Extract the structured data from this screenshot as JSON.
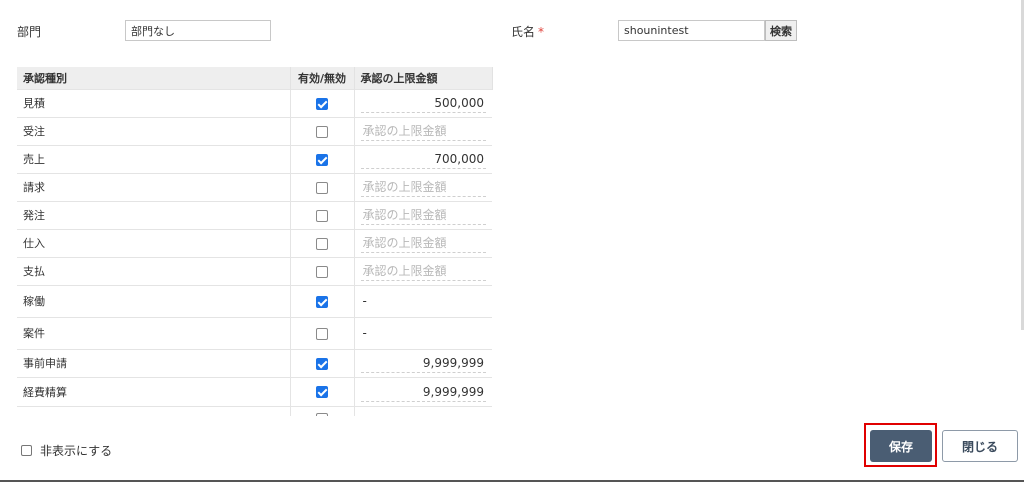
{
  "form": {
    "department_label": "部門",
    "department_value": "部門なし",
    "name_label": "氏名",
    "name_required_mark": "*",
    "name_value": "shounintest",
    "search_label": "検索"
  },
  "table": {
    "headers": [
      "承認種別",
      "有効/無効",
      "承認の上限金額"
    ],
    "amount_placeholder": "承認の上限金額",
    "rows": [
      {
        "type": "見積",
        "enabled": true,
        "amount": "500,000"
      },
      {
        "type": "受注",
        "enabled": false,
        "amount": ""
      },
      {
        "type": "売上",
        "enabled": true,
        "amount": "700,000"
      },
      {
        "type": "請求",
        "enabled": false,
        "amount": ""
      },
      {
        "type": "発注",
        "enabled": false,
        "amount": ""
      },
      {
        "type": "仕入",
        "enabled": false,
        "amount": ""
      },
      {
        "type": "支払",
        "enabled": false,
        "amount": ""
      },
      {
        "type": "稼働",
        "enabled": true,
        "amount": "-"
      },
      {
        "type": "案件",
        "enabled": false,
        "amount": "-"
      },
      {
        "type": "事前申請",
        "enabled": true,
        "amount": "9,999,999"
      },
      {
        "type": "経費精算",
        "enabled": true,
        "amount": "9,999,999"
      },
      {
        "type": "",
        "enabled": false,
        "amount": ""
      }
    ]
  },
  "footer": {
    "hide_label": "非表示にする",
    "hide_checked": false,
    "save_label": "保存",
    "close_label": "閉じる"
  },
  "colors": {
    "save_bg": "#4a5d73",
    "highlight": "#e00000",
    "checkbox_on": "#1a73e8"
  }
}
